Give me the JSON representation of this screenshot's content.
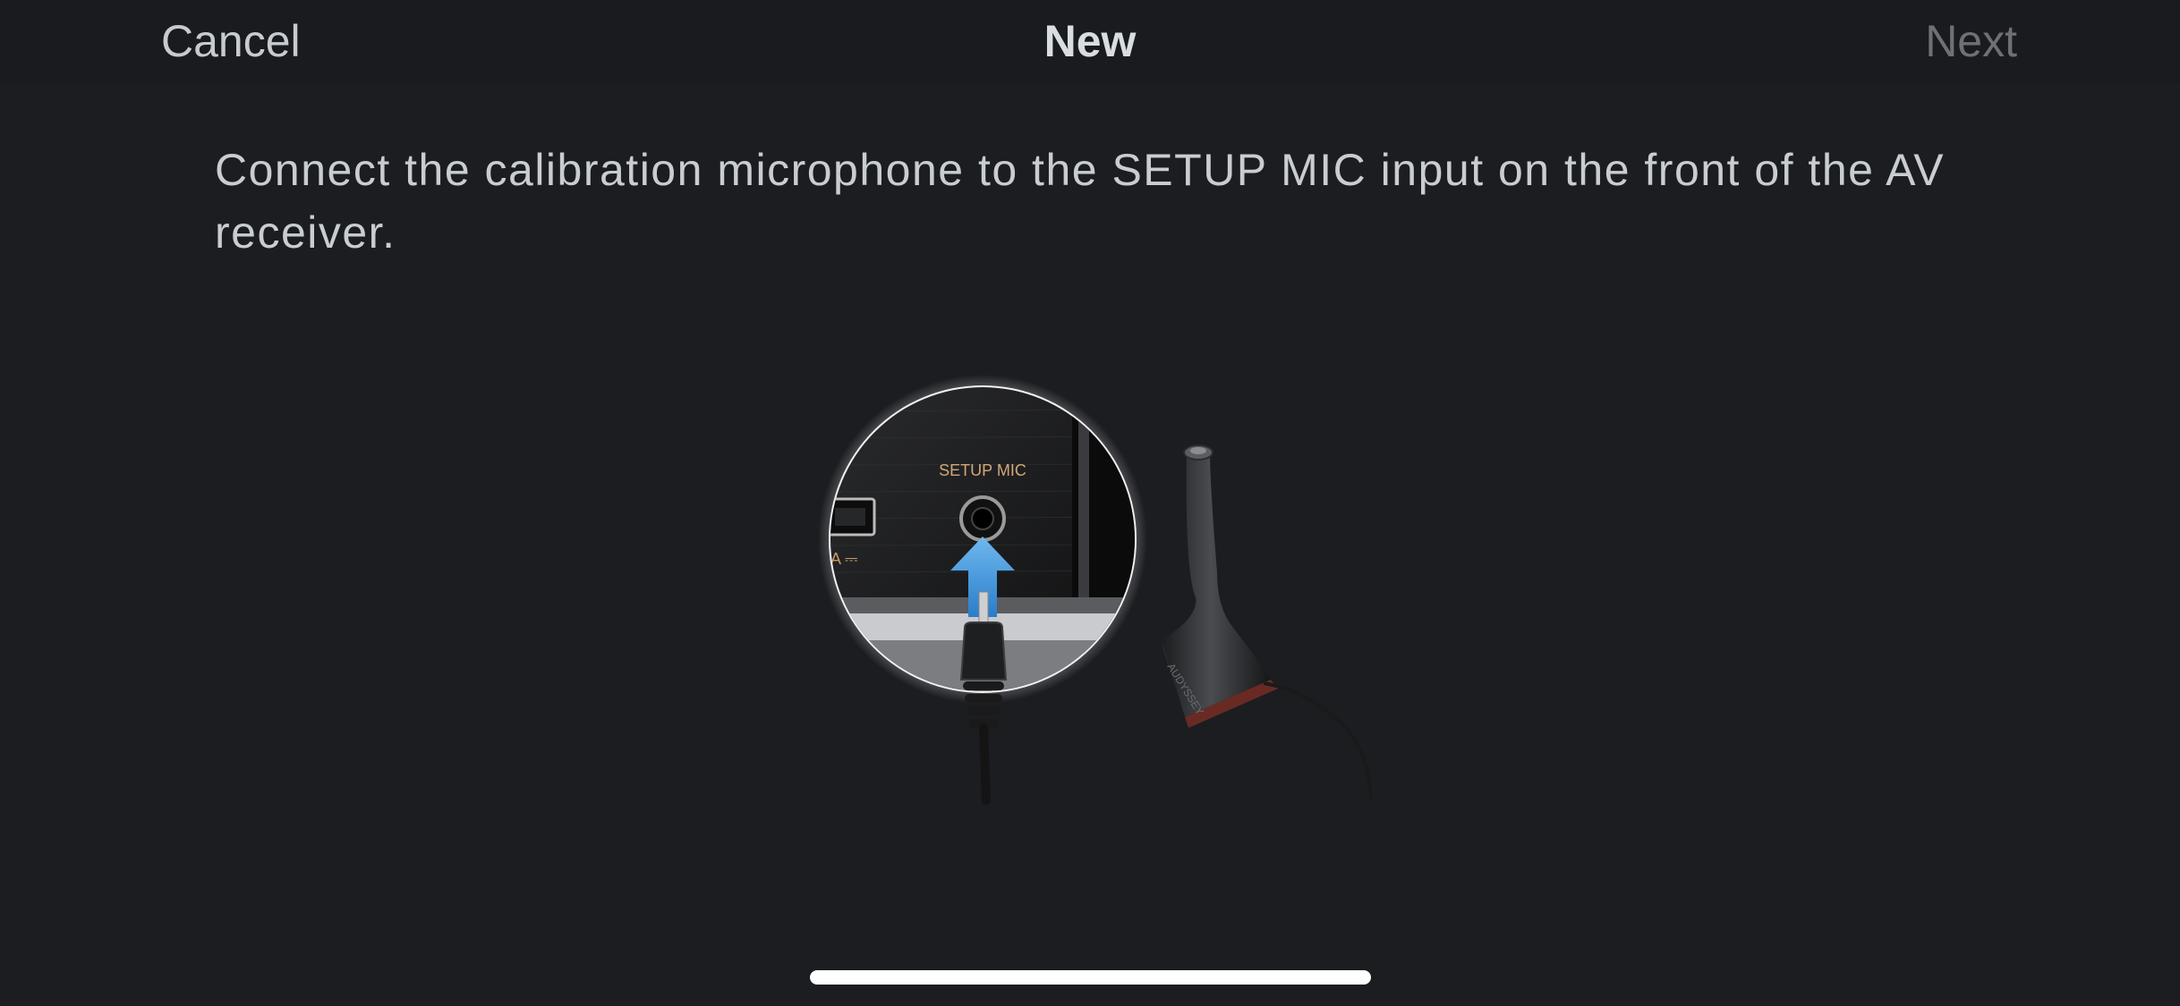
{
  "nav": {
    "cancel_label": "Cancel",
    "title": "New",
    "next_label": "Next"
  },
  "instruction": "Connect the calibration microphone to the SETUP MIC input on the front of the AV receiver.",
  "illustration": {
    "jack_label": "SETUP MIC"
  },
  "colors": {
    "background": "#1c1d21",
    "nav_background": "#1a1b1e",
    "arrow": "#4a9be0",
    "disabled_text": "#6d7176"
  }
}
